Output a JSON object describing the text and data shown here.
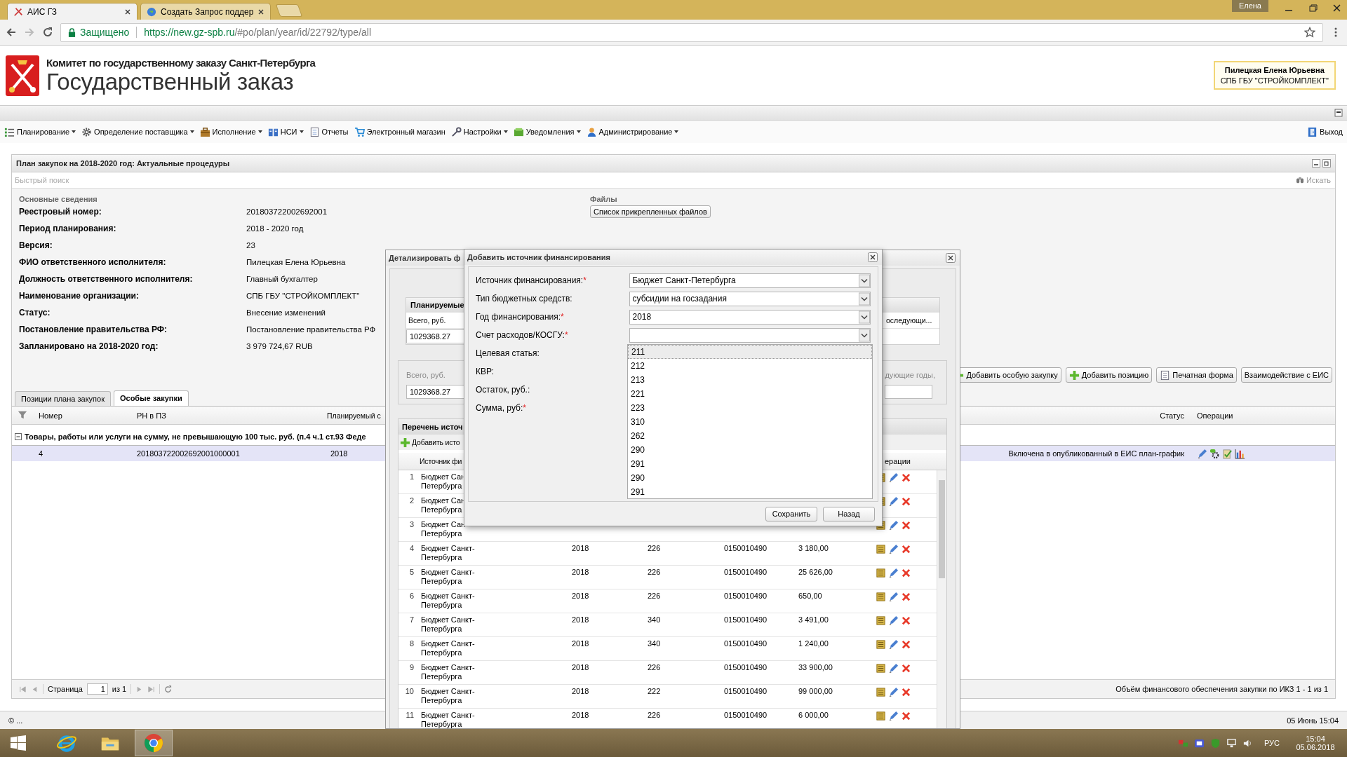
{
  "browser": {
    "tabs": [
      {
        "title": "АИС ГЗ",
        "selected": true
      },
      {
        "title": "Создать Запрос поддер",
        "selected": false
      }
    ],
    "profile": "Елена",
    "secure_label": "Защищено",
    "url_host": "https://new.gz-spb.ru",
    "url_path": "/#po/plan/year/id/22792/type/all"
  },
  "header": {
    "org": "Комитет по государственному заказу Санкт-Петербурга",
    "title": "Государственный заказ",
    "user_name": "Пилецкая Елена Юрьевна",
    "user_org": "СПБ ГБУ \"СТРОЙКОМПЛЕКТ\""
  },
  "menu": {
    "items": [
      {
        "label": "Планирование",
        "kind": "list",
        "dropdown": true
      },
      {
        "label": "Определение поставщика",
        "kind": "gear",
        "dropdown": true
      },
      {
        "label": "Исполнение",
        "kind": "briefcase",
        "dropdown": true
      },
      {
        "label": "НСИ",
        "kind": "book",
        "dropdown": true
      },
      {
        "label": "Отчеты",
        "kind": "document",
        "dropdown": false
      },
      {
        "label": "Электронный магазин",
        "kind": "cart",
        "dropdown": false
      },
      {
        "label": "Настройки",
        "kind": "wrench",
        "dropdown": true
      },
      {
        "label": "Уведомления",
        "kind": "tray",
        "dropdown": true
      },
      {
        "label": "Администрирование",
        "kind": "person",
        "dropdown": true
      }
    ],
    "logout": "Выход"
  },
  "panel": {
    "title": "План закупок на 2018-2020 год: Актуальные процедуры",
    "search_placeholder": "Быстрый поиск",
    "search_button": "Искать",
    "section_title": "Основные сведения",
    "fields": [
      {
        "label": "Реестровый номер:",
        "value": "201803722002692001"
      },
      {
        "label": "Период планирования:",
        "value": "2018 - 2020 год"
      },
      {
        "label": "Версия:",
        "value": "23"
      },
      {
        "label": "ФИО ответственного исполнителя:",
        "value": "Пилецкая Елена Юрьевна"
      },
      {
        "label": "Должность ответственного исполнителя:",
        "value": "Главный бухгалтер"
      },
      {
        "label": "Наименование организации:",
        "value": "СПБ ГБУ \"СТРОЙКОМПЛЕКТ\""
      },
      {
        "label": "Статус:",
        "value": "Внесение изменений"
      },
      {
        "label": "Постановление правительства РФ:",
        "value": "Постановление правительства РФ"
      },
      {
        "label": "Запланировано на 2018-2020 год:",
        "value": "3 979 724,67 RUB"
      }
    ],
    "files_title": "Файлы",
    "files_button": "Список прикрепленных файлов",
    "toolbar": [
      {
        "label": "Добавить особую закупку",
        "kind": "plus"
      },
      {
        "label": "Добавить позицию",
        "kind": "plus"
      },
      {
        "label": "Печатная форма",
        "kind": "document"
      },
      {
        "label": "Взаимодействие с ЕИС",
        "kind": "plain"
      }
    ],
    "tabs": [
      {
        "label": "Позиции плана закупок",
        "selected": false
      },
      {
        "label": "Особые закупки",
        "selected": true
      }
    ],
    "grid": {
      "columns": [
        "Номер",
        "РН в ПЗ",
        "Планируемый с",
        "Статус",
        "Операции"
      ],
      "group": {
        "label": "Товары, работы или услуги на сумму, не превышающую 100 тыс. руб. (п.4 ч.1 ст.93 Феде",
        "expanded": true
      },
      "rows": [
        {
          "number": "4",
          "rn": "201803722002692001000001",
          "year": "2018",
          "status": "Включена в опубликованный в ЕИС план-график",
          "selected": true
        }
      ]
    },
    "paging": {
      "page_label": "Страница",
      "page": "1",
      "of": "из 1",
      "summary": "Объём финансового обеспечения закупки по ИКЗ 1 - 1 из 1"
    }
  },
  "status_bar": {
    "left": "© ...",
    "right": "05 Июнь 15:04"
  },
  "detail_window": {
    "title": "Детализировать ф",
    "planned_header": "Планируемые",
    "total_label": "Всего, руб.",
    "total_value": "1029368.27",
    "next_header": "оследующи...",
    "total2_label": "Всего, руб.",
    "total2_value": "1029368.27",
    "next_label": "дующие годы,",
    "list_title": "Перечень источ",
    "add_button": "Добавить исто",
    "source_header": "Источник фи",
    "ops_header": "ерации",
    "rows": [
      {
        "number": "1",
        "source": [
          "Бюджет Сан",
          "Петербурга"
        ]
      },
      {
        "number": "2",
        "source": [
          "Бюджет Сан",
          "Петербурга"
        ]
      },
      {
        "number": "3",
        "source": [
          "Бюджет Сан",
          "Петербурга"
        ]
      },
      {
        "number": "4",
        "source": [
          "Бюджет Санкт-",
          "Петербурга"
        ],
        "year": "2018",
        "kosgu": "226",
        "kcsr": "0150010490",
        "sum": "3 180,00"
      },
      {
        "number": "5",
        "source": [
          "Бюджет Санкт-",
          "Петербурга"
        ],
        "year": "2018",
        "kosgu": "226",
        "kcsr": "0150010490",
        "sum": "25 626,00"
      },
      {
        "number": "6",
        "source": [
          "Бюджет Санкт-",
          "Петербурга"
        ],
        "year": "2018",
        "kosgu": "226",
        "kcsr": "0150010490",
        "sum": "650,00"
      },
      {
        "number": "7",
        "source": [
          "Бюджет Санкт-",
          "Петербурга"
        ],
        "year": "2018",
        "kosgu": "340",
        "kcsr": "0150010490",
        "sum": "3 491,00"
      },
      {
        "number": "8",
        "source": [
          "Бюджет Санкт-",
          "Петербурга"
        ],
        "year": "2018",
        "kosgu": "340",
        "kcsr": "0150010490",
        "sum": "1 240,00"
      },
      {
        "number": "9",
        "source": [
          "Бюджет Санкт-",
          "Петербурга"
        ],
        "year": "2018",
        "kosgu": "226",
        "kcsr": "0150010490",
        "sum": "33 900,00"
      },
      {
        "number": "10",
        "source": [
          "Бюджет Санкт-",
          "Петербурга"
        ],
        "year": "2018",
        "kosgu": "222",
        "kcsr": "0150010490",
        "sum": "99 000,00"
      },
      {
        "number": "11",
        "source": [
          "Бюджет Санкт-",
          "Петербурга"
        ],
        "year": "2018",
        "kosgu": "226",
        "kcsr": "0150010490",
        "sum": "6 000,00"
      }
    ]
  },
  "source_dialog": {
    "title": "Добавить источник финансирования",
    "fields": [
      {
        "label": "Источник финансирования:",
        "required_mark": "*",
        "kind": "combo",
        "value": "Бюджет Санкт-Петербурга"
      },
      {
        "label": "Тип бюджетных средств:",
        "kind": "combo",
        "value": "субсидии на госзадания"
      },
      {
        "label": "Год финансирования:",
        "required_mark": "*",
        "kind": "combo",
        "value": "2018"
      },
      {
        "label": "Счет расходов/КОСГУ:",
        "required_mark": "*",
        "kind": "combo"
      },
      {
        "label": "Целевая статья:",
        "kind": "label"
      },
      {
        "label": "КВР:",
        "kind": "label"
      },
      {
        "label": "Остаток, руб.:",
        "kind": "label"
      },
      {
        "label": "Сумма, руб:",
        "required_mark": "*",
        "kind": "label"
      }
    ],
    "options": [
      {
        "label": "211",
        "selected": true
      },
      {
        "label": "212",
        "selected": false
      },
      {
        "label": "213",
        "selected": false
      },
      {
        "label": "221",
        "selected": false
      },
      {
        "label": "223",
        "selected": false
      },
      {
        "label": "310",
        "selected": false
      },
      {
        "label": "262",
        "selected": false
      },
      {
        "label": "290",
        "selected": false
      },
      {
        "label": "291",
        "selected": false
      },
      {
        "label": "290",
        "selected": false
      },
      {
        "label": "291",
        "selected": false
      }
    ],
    "buttons": [
      "Сохранить",
      "Назад"
    ]
  },
  "taskbar": {
    "apps": [
      {
        "kind": "ie",
        "selected": false
      },
      {
        "kind": "explorer",
        "selected": false
      },
      {
        "kind": "chrome",
        "selected": true
      }
    ],
    "lang": "РУС",
    "time": "15:04",
    "date": "05.06.2018"
  }
}
